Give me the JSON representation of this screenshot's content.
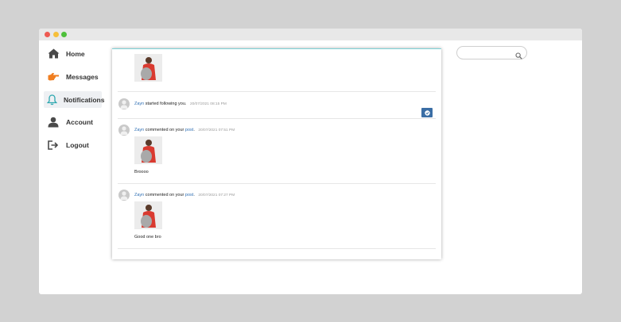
{
  "sidebar": {
    "items": [
      {
        "label": "Home",
        "icon": "home-icon"
      },
      {
        "label": "Messages",
        "icon": "pointing-hand-icon"
      },
      {
        "label": "Notifications",
        "icon": "bell-icon"
      },
      {
        "label": "Account",
        "icon": "user-icon"
      },
      {
        "label": "Logout",
        "icon": "logout-icon"
      }
    ],
    "active": "Notifications"
  },
  "notifications": [
    {
      "user": "Zayn",
      "action": "started following you.",
      "time": "20/07/2021 08:15 PM"
    },
    {
      "user": "Zayn",
      "action": "commented on your",
      "link": "post",
      "punct": ".",
      "time": "20/07/2021 07:51 PM",
      "comment": "Broooo"
    },
    {
      "user": "Zayn",
      "action": "commented on your",
      "link": "post",
      "punct": ".",
      "time": "20/07/2021 07:27 PM",
      "comment": "Good one bro"
    }
  ],
  "colors": {
    "link": "#2f6fb4",
    "accent": "#3b6ea5",
    "messages_icon": "#f07f22",
    "notifications_icon": "#2ea8b0",
    "panel_border": "#7fd3d8"
  },
  "search": {
    "placeholder": "",
    "value": ""
  }
}
